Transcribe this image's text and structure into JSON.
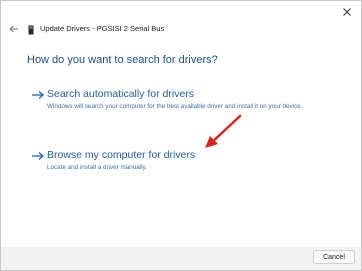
{
  "window": {
    "title": "Update Drivers - PGSISI 2 Serial Bus"
  },
  "main": {
    "heading": "How do you want to search for drivers?",
    "options": [
      {
        "title": "Search automatically for drivers",
        "description": "Windows will search your computer for the best available driver and install it on your device.",
        "icon": "arrow-right-icon"
      },
      {
        "title": "Browse my computer for drivers",
        "description": "Locate and install a driver manually.",
        "icon": "arrow-right-icon"
      }
    ]
  },
  "annotation": {
    "icon": "red-arrow-icon",
    "color": "#d9221c"
  },
  "footer": {
    "cancel_label": "Cancel"
  },
  "colors": {
    "link": "#1f5fa6",
    "heading": "#1a4e8a",
    "footer_bg": "#f3f3f3"
  }
}
